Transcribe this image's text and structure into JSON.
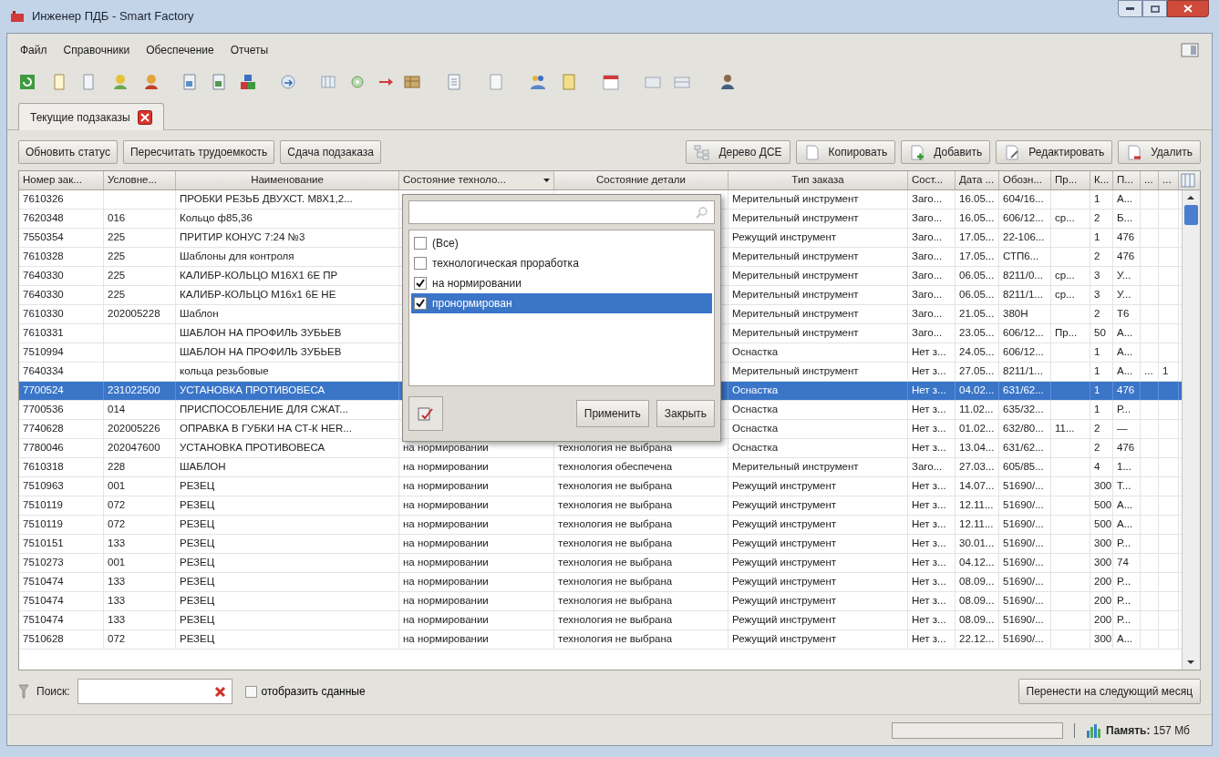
{
  "window": {
    "title": "Инженер ПДБ - Smart Factory"
  },
  "menu": [
    "Файл",
    "Справочники",
    "Обеспечение",
    "Отчеты"
  ],
  "tabs": [
    {
      "label": "Текущие подзаказы",
      "selected": true
    }
  ],
  "actions_left": [
    "Обновить статус",
    "Пересчитать трудоемкость",
    "Сдача подзаказа"
  ],
  "actions_right": [
    {
      "kind": "tree",
      "label": "Дерево ДСЕ"
    },
    {
      "kind": "copy",
      "label": "Копировать"
    },
    {
      "kind": "add",
      "label": "Добавить"
    },
    {
      "kind": "edit",
      "label": "Редактировать"
    },
    {
      "kind": "delete",
      "label": "Удалить"
    }
  ],
  "table": {
    "columns": [
      {
        "label": "Номер зак...",
        "filter": false
      },
      {
        "label": "Условне...",
        "filter": false
      },
      {
        "label": "Наименование",
        "filter": false
      },
      {
        "label": "Состояние техноло...",
        "filter": true
      },
      {
        "label": "Состояние детали",
        "filter": false
      },
      {
        "label": "Тип заказа",
        "filter": false
      },
      {
        "label": "Сост...",
        "filter": false
      },
      {
        "label": "Дата ...",
        "filter": false
      },
      {
        "label": "Обозн...",
        "filter": false
      },
      {
        "label": "Пр...",
        "filter": false
      },
      {
        "label": "К...",
        "filter": false
      },
      {
        "label": "П...",
        "filter": false
      },
      {
        "label": "...",
        "filter": false
      },
      {
        "label": "...",
        "filter": false
      }
    ],
    "rows": [
      {
        "selected": false,
        "cells": [
          "7610326",
          null,
          "ПРОБКИ РЕЗЬБ ДВУХСТ. М8Х1,2...",
          null,
          null,
          "Мерительный инструмент",
          "Заго...",
          "16.05...",
          "604/16...",
          null,
          "1",
          "А...",
          null,
          null
        ]
      },
      {
        "selected": false,
        "cells": [
          "7620348",
          "016",
          "Кольцо ф85,36",
          null,
          null,
          "Мерительный инструмент",
          "Заго...",
          "16.05...",
          "606/12...",
          "ср...",
          "2",
          "Б...",
          null,
          null
        ]
      },
      {
        "selected": false,
        "cells": [
          "7550354",
          "225",
          "ПРИТИР КОНУС 7:24 №3",
          null,
          null,
          "Режущий инструмент",
          "Заго...",
          "17.05...",
          "22-106...",
          null,
          "1",
          "476",
          null,
          null
        ]
      },
      {
        "selected": false,
        "cells": [
          "7610328",
          "225",
          "Шаблоны для контроля",
          null,
          null,
          "Мерительный инструмент",
          "Заго...",
          "17.05...",
          "СТП6...",
          null,
          "2",
          "476",
          null,
          null
        ]
      },
      {
        "selected": false,
        "cells": [
          "7640330",
          "225",
          "КАЛИБР-КОЛЬЦО М16Х1 6Е ПР",
          null,
          null,
          "Мерительный инструмент",
          "Заго...",
          "06.05...",
          "8211/0...",
          "ср...",
          "3",
          "У...",
          null,
          null
        ]
      },
      {
        "selected": false,
        "cells": [
          "7640330",
          "225",
          "КАЛИБР-КОЛЬЦО М16х1 6Е НЕ",
          null,
          null,
          "Мерительный инструмент",
          "Заго...",
          "06.05...",
          "8211/1...",
          "ср...",
          "3",
          "У...",
          null,
          null
        ]
      },
      {
        "selected": false,
        "cells": [
          "7610330",
          "202005228",
          "Шаблон",
          null,
          null,
          "Мерительный инструмент",
          "Заго...",
          "21.05...",
          "380Н",
          null,
          "2",
          "Т6",
          null,
          null
        ]
      },
      {
        "selected": false,
        "cells": [
          "7610331",
          null,
          "ШАБЛОН НА ПРОФИЛЬ ЗУБЬЕВ",
          null,
          null,
          "Мерительный инструмент",
          "Заго...",
          "23.05...",
          "606/12...",
          "Пр...",
          "50",
          "А...",
          null,
          null
        ]
      },
      {
        "selected": false,
        "cells": [
          "7510994",
          null,
          "ШАБЛОН НА ПРОФИЛЬ ЗУБЬЕВ",
          null,
          null,
          "Оснастка",
          "Нет з...",
          "24.05...",
          "606/12...",
          null,
          "1",
          "А...",
          null,
          null
        ]
      },
      {
        "selected": false,
        "cells": [
          "7640334",
          null,
          "кольца резьбовые",
          null,
          null,
          "Мерительный инструмент",
          "Нет з...",
          "27.05...",
          "8211/1...",
          null,
          "1",
          "А...",
          "...",
          "1"
        ]
      },
      {
        "selected": true,
        "cells": [
          "7700524",
          "231022500",
          "УСТАНОВКА ПРОТИВОВЕСА",
          null,
          null,
          "Оснастка",
          "Нет з...",
          "04.02...",
          "631/62...",
          null,
          "1",
          "476",
          null,
          null
        ]
      },
      {
        "selected": false,
        "cells": [
          "7700536",
          "014",
          "ПРИСПОСОБЛЕНИЕ ДЛЯ  СЖАТ...",
          null,
          null,
          "Оснастка",
          "Нет з...",
          "11.02...",
          "635/32...",
          null,
          "1",
          "Р...",
          null,
          null
        ]
      },
      {
        "selected": false,
        "cells": [
          "7740628",
          "202005226",
          "ОПРАВКА В ГУБКИ НА СТ-К HER...",
          null,
          null,
          "Оснастка",
          "Нет з...",
          "01.02...",
          "632/80...",
          "11...",
          "2",
          "—",
          null,
          null
        ]
      },
      {
        "selected": false,
        "cells": [
          "7780046",
          "202047600",
          "УСТАНОВКА ПРОТИВОВЕСА",
          "на нормировании",
          "технология не выбрана",
          "Оснастка",
          "Нет з...",
          "13.04...",
          "631/62...",
          null,
          "2",
          "476",
          null,
          null
        ]
      },
      {
        "selected": false,
        "cells": [
          "7610318",
          "228",
          "ШАБЛОН",
          "на нормировании",
          "технология обеспечена",
          "Мерительный инструмент",
          "Заго...",
          "27.03...",
          "605/85...",
          null,
          "4",
          "1...",
          null,
          null
        ]
      },
      {
        "selected": false,
        "cells": [
          "7510963",
          "001",
          "РЕЗЕЦ",
          "на нормировании",
          "технология не выбрана",
          "Режущий инструмент",
          "Нет з...",
          "14.07...",
          "51690/...",
          null,
          "300",
          "Т...",
          null,
          null
        ]
      },
      {
        "selected": false,
        "cells": [
          "7510119",
          "072",
          "РЕЗЕЦ",
          "на нормировании",
          "технология не выбрана",
          "Режущий инструмент",
          "Нет з...",
          "12.11...",
          "51690/...",
          null,
          "500",
          "А...",
          null,
          null
        ]
      },
      {
        "selected": false,
        "cells": [
          "7510119",
          "072",
          "РЕЗЕЦ",
          "на нормировании",
          "технология не выбрана",
          "Режущий инструмент",
          "Нет з...",
          "12.11...",
          "51690/...",
          null,
          "500",
          "А...",
          null,
          null
        ]
      },
      {
        "selected": false,
        "cells": [
          "7510151",
          "133",
          "РЕЗЕЦ",
          "на нормировании",
          "технология не выбрана",
          "Режущий инструмент",
          "Нет з...",
          "30.01...",
          "51690/...",
          null,
          "300",
          "Р...",
          null,
          null
        ]
      },
      {
        "selected": false,
        "cells": [
          "7510273",
          "001",
          "РЕЗЕЦ",
          "на нормировании",
          "технология не выбрана",
          "Режущий инструмент",
          "Нет з...",
          "04.12...",
          "51690/...",
          null,
          "300",
          "74",
          null,
          null
        ]
      },
      {
        "selected": false,
        "cells": [
          "7510474",
          "133",
          "РЕЗЕЦ",
          "на нормировании",
          "технология не выбрана",
          "Режущий инструмент",
          "Нет з...",
          "08.09...",
          "51690/...",
          null,
          "200",
          "Р...",
          null,
          null
        ]
      },
      {
        "selected": false,
        "cells": [
          "7510474",
          "133",
          "РЕЗЕЦ",
          "на нормировании",
          "технология не выбрана",
          "Режущий инструмент",
          "Нет з...",
          "08.09...",
          "51690/...",
          null,
          "200",
          "Р...",
          null,
          null
        ]
      },
      {
        "selected": false,
        "cells": [
          "7510474",
          "133",
          "РЕЗЕЦ",
          "на нормировании",
          "технология не выбрана",
          "Режущий инструмент",
          "Нет з...",
          "08.09...",
          "51690/...",
          null,
          "200",
          "Р...",
          null,
          null
        ]
      },
      {
        "selected": false,
        "cells": [
          "7510628",
          "072",
          "РЕЗЕЦ",
          "на нормировании",
          "технология не выбрана",
          "Режущий инструмент",
          "Нет з...",
          "22.12...",
          "51690/...",
          null,
          "300",
          "А...",
          null,
          null
        ]
      }
    ]
  },
  "filter_popup": {
    "items": [
      {
        "label": "(Все)",
        "checked": false,
        "selected": false
      },
      {
        "label": "технологическая проработка",
        "checked": false,
        "selected": false
      },
      {
        "label": "на нормировании",
        "checked": true,
        "selected": false
      },
      {
        "label": "пронормирован",
        "checked": true,
        "selected": true
      }
    ],
    "buttons": [
      "Применить",
      "Закрыть"
    ]
  },
  "bottom": {
    "search_label": "Поиск:",
    "show_submitted": {
      "label": "отобразить сданные",
      "checked": false
    },
    "move_button": "Перенести на следующий месяц"
  },
  "status_bar": {
    "progress": {
      "level": 0
    },
    "memory": "**Память:** 157 Мб"
  }
}
